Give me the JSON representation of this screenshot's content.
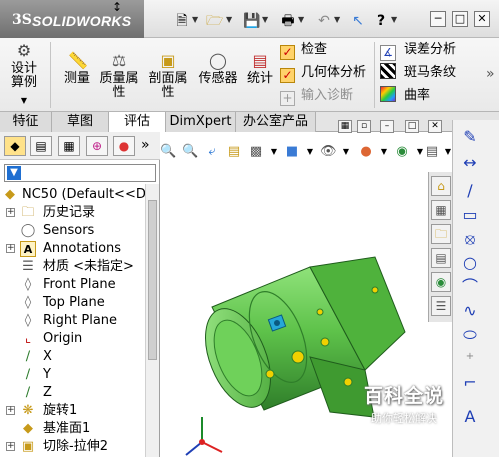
{
  "app": {
    "logo_ds": "3S",
    "logo_name": "SOLIDWORKS"
  },
  "titlebar": {
    "grip_glyph": "↕",
    "help_glyph": "?",
    "win_buttons": [
      "─",
      "□",
      "✕"
    ]
  },
  "ribbon": {
    "design_study": "设计算例",
    "measure": "测量",
    "mass_props": "质量属性",
    "section_props": "剖面属性",
    "sensor": "传感器",
    "statistics": "统计",
    "check": "检查",
    "geometry_analysis": "几何体分析",
    "import_diagnostics": "输入诊断",
    "deviation_analysis": "误差分析",
    "zebra_stripes": "斑马条纹",
    "curvature": "曲率",
    "more_glyph": "»"
  },
  "tabs": [
    {
      "label": "特征"
    },
    {
      "label": "草图"
    },
    {
      "label": "评估"
    },
    {
      "label": "DimXpert"
    },
    {
      "label": "办公室产品"
    }
  ],
  "feature_tree": {
    "more_glyph": "»",
    "items": [
      {
        "label": "NC50  (Default<<De"
      },
      {
        "label": "历史记录"
      },
      {
        "label": "Sensors"
      },
      {
        "label": "Annotations"
      },
      {
        "label": "材质 <未指定>"
      },
      {
        "label": "Front Plane"
      },
      {
        "label": "Top Plane"
      },
      {
        "label": "Right Plane"
      },
      {
        "label": "Origin"
      },
      {
        "label": "X"
      },
      {
        "label": "Y"
      },
      {
        "label": "Z"
      },
      {
        "label": "旋转1"
      },
      {
        "label": "基准面1"
      },
      {
        "label": "切除-拉伸2"
      }
    ]
  },
  "watermark": {
    "main": "百科全说",
    "sub": "助你轻松解决"
  },
  "colors": {
    "part_green": "#5ec24a",
    "part_dark": "#2f7e2a",
    "accent_blue": "#1f3fb5"
  }
}
